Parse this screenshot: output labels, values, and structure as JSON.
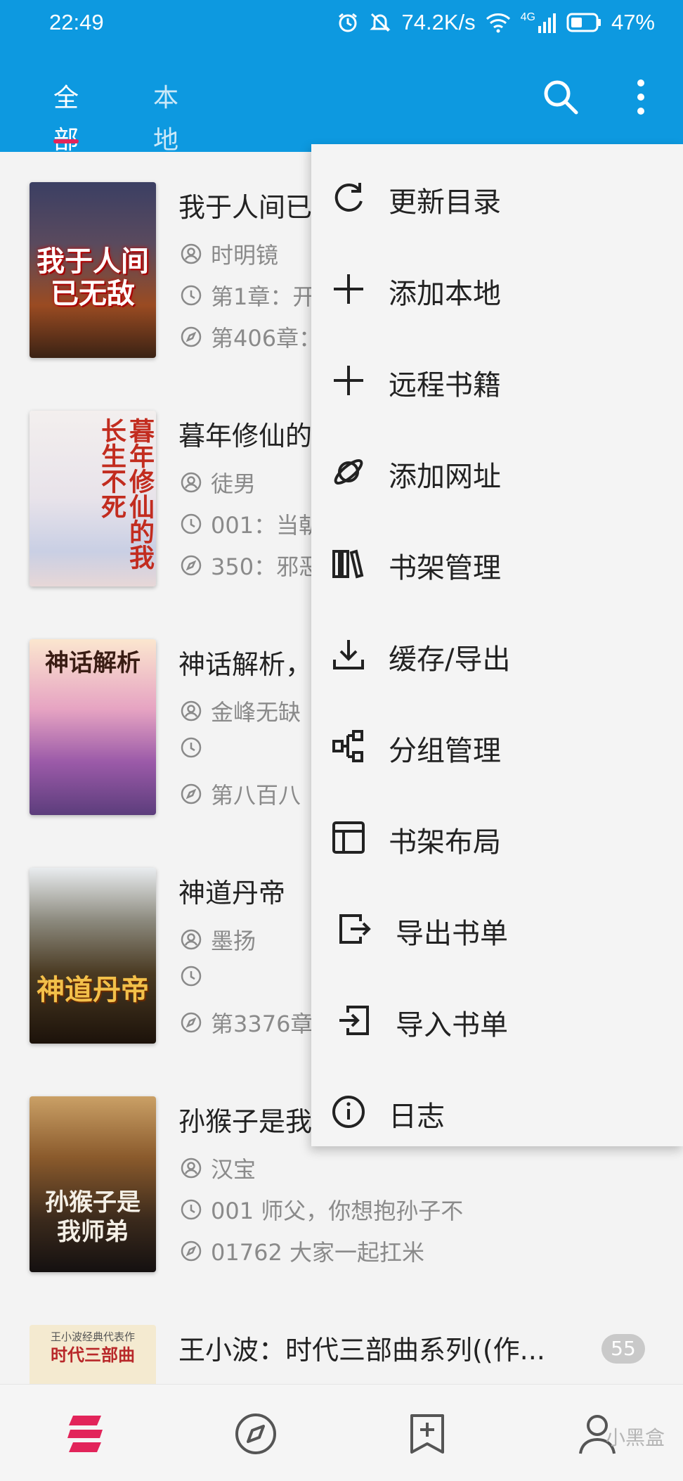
{
  "status_bar": {
    "time": "22:49",
    "net_speed": "74.2K/s",
    "signal_label": "4G",
    "battery": "47%"
  },
  "header": {
    "tabs": [
      {
        "label": "全部",
        "active": true
      },
      {
        "label": "本地",
        "active": false
      }
    ],
    "accent_color": "#0d99e0",
    "indicator_color": "#e2245a"
  },
  "books": [
    {
      "title": "我于人间已无敌",
      "author": "时明镜",
      "latest_read": "第1章：开",
      "latest_chapter": "第406章：",
      "cover_text": "我于人间已无敌"
    },
    {
      "title": "暮年修仙的",
      "author": "徒男",
      "latest_read": "001：当朝",
      "latest_chapter": "350：邪恶",
      "cover_text": "暮年修仙的我长生不死"
    },
    {
      "title": "神话解析，",
      "author": "金峰无缺",
      "latest_read": "",
      "latest_chapter": "第八百八",
      "cover_text": "神话解析"
    },
    {
      "title": "神道丹帝",
      "author": "墨扬",
      "latest_read": "",
      "latest_chapter": "第3376章",
      "cover_text": "神道丹帝"
    },
    {
      "title": "孙猴子是我",
      "author": "汉宝",
      "latest_read": "001 师父，你想抱孙子不",
      "latest_chapter": "01762 大家一起扛米",
      "cover_text": "孙猴子是我师弟"
    },
    {
      "title": "王小波：时代三部曲系列((作...",
      "author": "",
      "latest_read": "",
      "latest_chapter": "",
      "cover_text": "时代三部曲",
      "cover_subtext": "王小波经典代表作",
      "unread": "55"
    }
  ],
  "menu": {
    "items": [
      {
        "label": "更新目录",
        "icon": "refresh-icon"
      },
      {
        "label": "添加本地",
        "icon": "plus-icon"
      },
      {
        "label": "远程书籍",
        "icon": "plus-icon"
      },
      {
        "label": "添加网址",
        "icon": "planet-icon"
      },
      {
        "label": "书架管理",
        "icon": "bookshelf-icon"
      },
      {
        "label": "缓存/导出",
        "icon": "download-icon"
      },
      {
        "label": "分组管理",
        "icon": "group-icon"
      },
      {
        "label": "书架布局",
        "icon": "layout-icon"
      },
      {
        "label": "导出书单",
        "icon": "export-icon"
      },
      {
        "label": "导入书单",
        "icon": "import-icon"
      },
      {
        "label": "日志",
        "icon": "info-icon"
      }
    ]
  },
  "bottom_nav": {
    "items": [
      {
        "icon": "bookshelf-logo-icon",
        "active": true
      },
      {
        "icon": "compass-icon"
      },
      {
        "icon": "bookmark-add-icon"
      },
      {
        "icon": "profile-icon"
      }
    ],
    "watermark": "小黑盒"
  }
}
